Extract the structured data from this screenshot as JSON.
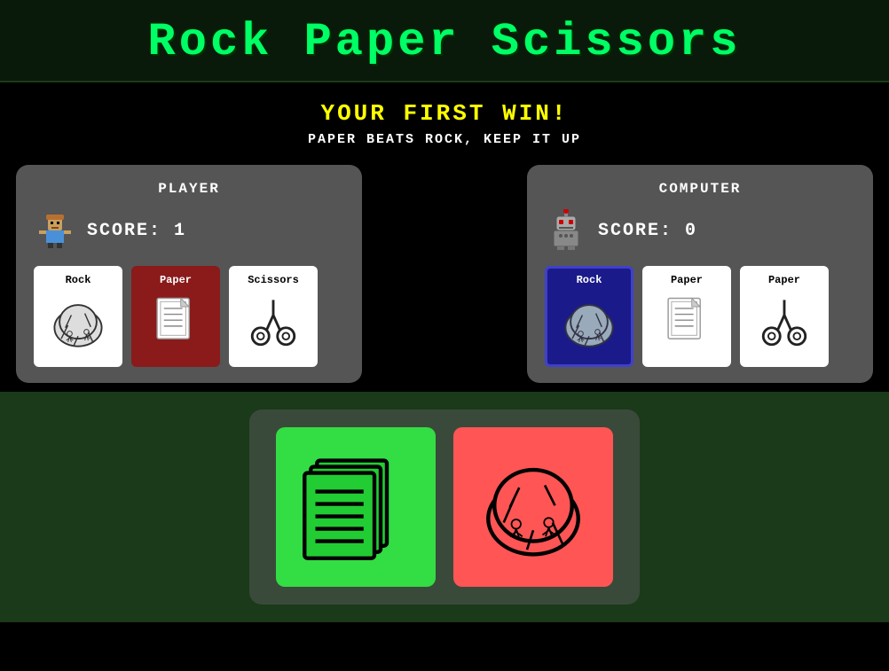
{
  "header": {
    "title": "Rock Paper Scissors"
  },
  "win_banner": {
    "title": "YOUR FIRST WIN!",
    "subtitle": "PAPER BEATS ROCK, KEEP IT UP"
  },
  "player": {
    "label": "PLAYER",
    "score_label": "SCORE: 1",
    "score": 1,
    "cards": [
      {
        "id": "rock",
        "label": "Rock",
        "selected": false
      },
      {
        "id": "paper",
        "label": "Paper",
        "selected": true
      },
      {
        "id": "scissors",
        "label": "Scissors",
        "selected": false
      }
    ]
  },
  "computer": {
    "label": "COMPUTER",
    "score_label": "SCORE: 0",
    "score": 0,
    "cards": [
      {
        "id": "rock",
        "label": "Rock",
        "selected": true
      },
      {
        "id": "paper",
        "label": "Paper",
        "selected": false
      },
      {
        "id": "scissors2",
        "label": "Paper",
        "selected": false
      }
    ]
  },
  "bottom_cards": [
    {
      "id": "paper-big",
      "color": "green",
      "type": "paper"
    },
    {
      "id": "rock-big",
      "color": "red",
      "type": "rock"
    }
  ]
}
